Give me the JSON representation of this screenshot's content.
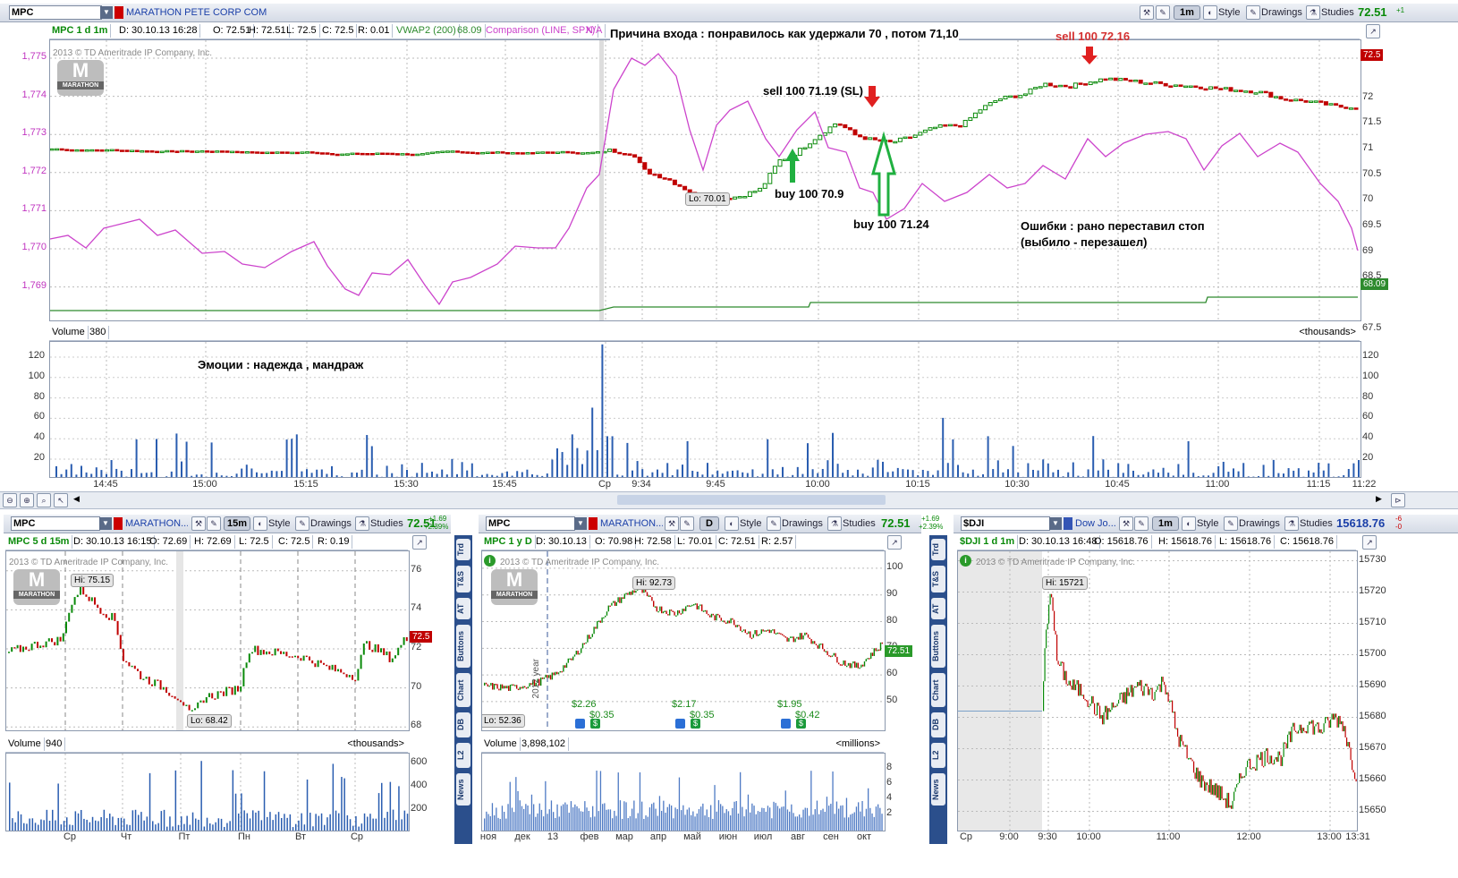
{
  "main_panel": {
    "symbol": "MPC",
    "company": "MARATHON PETE CORP COM",
    "aggregation": "1m",
    "style_label": "Style",
    "drawings_label": "Drawings",
    "studies_label": "Studies",
    "last_price": "72.51",
    "change": "+1",
    "header": {
      "title": "MPC 1 d 1m",
      "date": "D: 30.10.13 16:28",
      "open": "O: 72.51",
      "high": "H: 72.51",
      "low": "L: 72.5",
      "close": "C: 72.5",
      "range": "R: 0.01",
      "vwap_label": "VWAP2 (200)",
      "vwap_value": "68.09",
      "comparison_label": "Comparison (LINE, SPX)",
      "comparison_value": "N/A"
    },
    "copyright": "2013 © TD Ameritrade IP Company, Inc.",
    "logo_text": "MARATHON",
    "left_axis": [
      "1,775",
      "1,774",
      "1,773",
      "1,772",
      "1,771",
      "1,770",
      "1,769"
    ],
    "right_axis": [
      "72.5",
      "72",
      "71.5",
      "71",
      "70.5",
      "70",
      "69.5",
      "69",
      "68.5",
      "68.09",
      "67.5"
    ],
    "price_tag": "72.5",
    "vwap_tag": "68.09",
    "lo_callout": "Lo: 70.01",
    "annotations": {
      "reason": "Причина входа : понравилось как удержали 70 , потом 71,10",
      "sell_sl": "sell 100 71.19 (SL)",
      "buy1": "buy 100 70.9",
      "buy2": "buy 100 71.24",
      "sell2": "sell 100 72.16",
      "errors_line1": "Ошибки : рано переставил стоп",
      "errors_line2": "(выбило - перезашел)",
      "emotions": "Эмоции : надежда , мандраж"
    },
    "volume_label": "Volume",
    "volume_value": "380",
    "volume_units": "<thousands>",
    "volume_axis": [
      "120",
      "100",
      "80",
      "60",
      "40",
      "20"
    ],
    "time_axis": [
      "14:45",
      "15:00",
      "15:15",
      "15:30",
      "15:45",
      "Ср",
      "9:34",
      "9:45",
      "10:00",
      "10:15",
      "10:30",
      "10:45",
      "11:00",
      "11:15",
      "11:22"
    ]
  },
  "panel_5d": {
    "symbol": "MPC",
    "company": "MARATHON...",
    "aggregation": "15m",
    "style_label": "Style",
    "drawings_label": "Drawings",
    "studies_label": "Studies",
    "last_price": "72.51",
    "change_1": "+1.69",
    "change_2": "+2.39%",
    "header": {
      "title": "MPC 5 d 15m",
      "date": "D: 30.10.13 16:15",
      "open": "O: 72.69",
      "high": "H: 72.69",
      "low": "L: 72.5",
      "close": "C: 72.5",
      "range": "R: 0.19"
    },
    "copyright": "2013 © TD Ameritrade IP Company, Inc.",
    "hi_callout": "Hi: 75.15",
    "lo_callout": "Lo: 68.42",
    "price_axis": [
      "76",
      "74",
      "72",
      "70",
      "68"
    ],
    "price_tag": "72.5",
    "volume_label": "Volume",
    "volume_value": "940",
    "volume_units": "<thousands>",
    "volume_axis": [
      "600",
      "400",
      "200"
    ],
    "time_axis": [
      "Ср",
      "Чт",
      "Пт",
      "Пн",
      "Вт",
      "Ср"
    ]
  },
  "panel_1y": {
    "symbol": "MPC",
    "company": "MARATHON...",
    "aggregation": "D",
    "style_label": "Style",
    "drawings_label": "Drawings",
    "studies_label": "Studies",
    "last_price": "72.51",
    "change_1": "+1.69",
    "change_2": "+2.39%",
    "header": {
      "title": "MPC 1 y D",
      "date": "D: 30.10.13",
      "open": "O: 70.98",
      "high": "H: 72.58",
      "low": "L: 70.01",
      "close": "C: 72.51",
      "range": "R: 2.57"
    },
    "copyright": "2013 © TD Ameritrade IP Company, Inc.",
    "hi_callout": "Hi: 92.73",
    "lo_callout": "Lo: 52.36",
    "year_marker": "2012 year",
    "dividends": [
      "$2.26",
      "$2.17",
      "$1.95"
    ],
    "div_small": [
      "$0.35",
      "$0.35",
      "$0.42"
    ],
    "price_axis": [
      "100",
      "90",
      "80",
      "70",
      "60",
      "50"
    ],
    "price_tag": "72.51",
    "volume_label": "Volume",
    "volume_value": "3,898,102",
    "volume_units": "<millions>",
    "volume_axis": [
      "8",
      "6",
      "4",
      "2"
    ],
    "time_axis": [
      "ноя",
      "дек",
      "13",
      "фев",
      "мар",
      "апр",
      "май",
      "июн",
      "июл",
      "авг",
      "сен",
      "окт"
    ],
    "side_tabs": [
      "Trd",
      "T&S",
      "AT",
      "Buttons",
      "Chart",
      "DB",
      "L2",
      "News"
    ]
  },
  "panel_dji": {
    "symbol": "$DJI",
    "company": "Dow Jo...",
    "aggregation": "1m",
    "style_label": "Style",
    "drawings_label": "Drawings",
    "studies_label": "Studies",
    "last_price": "15618.76",
    "change_1": "-6",
    "change_2": "-0",
    "header": {
      "title": "$DJI 1 d 1m",
      "date": "D: 30.10.13 16:48",
      "open": "O: 15618.76",
      "high": "H: 15618.76",
      "low": "L: 15618.76",
      "close": "C: 15618.76"
    },
    "copyright": "2013 © TD Ameritrade IP Company, Inc.",
    "hi_callout": "Hi: 15721",
    "price_axis": [
      "15730",
      "15720",
      "15710",
      "15700",
      "15690",
      "15680",
      "15670",
      "15660",
      "15650"
    ],
    "time_axis": [
      "Ср",
      "9:00",
      "9:30",
      "10:00",
      "11:00",
      "12:00",
      "13:00",
      "13:31"
    ],
    "side_tabs": [
      "Trd",
      "T&S",
      "AT",
      "Buttons",
      "Chart",
      "DB",
      "L2",
      "News"
    ]
  },
  "colors": {
    "up": "#0a8a0a",
    "down": "#c00000",
    "comparison": "#cc44cc",
    "vwap": "#2e8b2e",
    "volume": "#2a5db0",
    "accent": "#1a3fa8"
  }
}
